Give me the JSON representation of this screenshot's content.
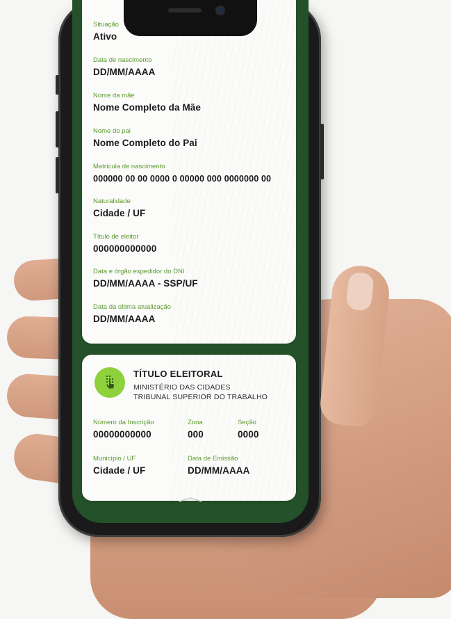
{
  "screen": {
    "personal_fields": [
      {
        "label": "Situação",
        "value": "Ativo"
      },
      {
        "label": "Data de nascimento",
        "value": "DD/MM/AAAA"
      },
      {
        "label": "Nome da mãe",
        "value": "Nome Completo da Mãe"
      },
      {
        "label": "Nome do pai",
        "value": "Nome Completo do Pai"
      },
      {
        "label": "Matrícula de nascimento",
        "value": "000000 00 00 0000 0 00000 000 0000000 00"
      },
      {
        "label": "Naturalidade",
        "value": "Cidade / UF"
      },
      {
        "label": "Título de eleitor",
        "value": "000000000000"
      },
      {
        "label": "Data e órgão expedidor do DNI",
        "value": "DD/MM/AAAA - SSP/UF"
      },
      {
        "label": "Data da última atualização",
        "value": "DD/MM/AAAA"
      }
    ],
    "voter_card": {
      "title": "TÍTULO ELEITORAL",
      "subtitle_1": "MINISTÉRIO DAS CIDADES",
      "subtitle_2": "TRIBUNAL SUPERIOR DO TRABALHO",
      "icon": "fingerprint-touch-icon",
      "fields": [
        {
          "label": "Número da Inscrição",
          "value": "00000000000"
        },
        {
          "label": "Zona",
          "value": "000"
        },
        {
          "label": "Seção",
          "value": "0000"
        },
        {
          "label": "Município / UF",
          "value": "Cidade / UF"
        },
        {
          "label": "Data de Emissão",
          "value": "DD/MM/AAAA"
        }
      ]
    }
  },
  "colors": {
    "label_green": "#5b9a2d",
    "screen_background": "#24502a",
    "badge_green": "#8ed13c"
  }
}
